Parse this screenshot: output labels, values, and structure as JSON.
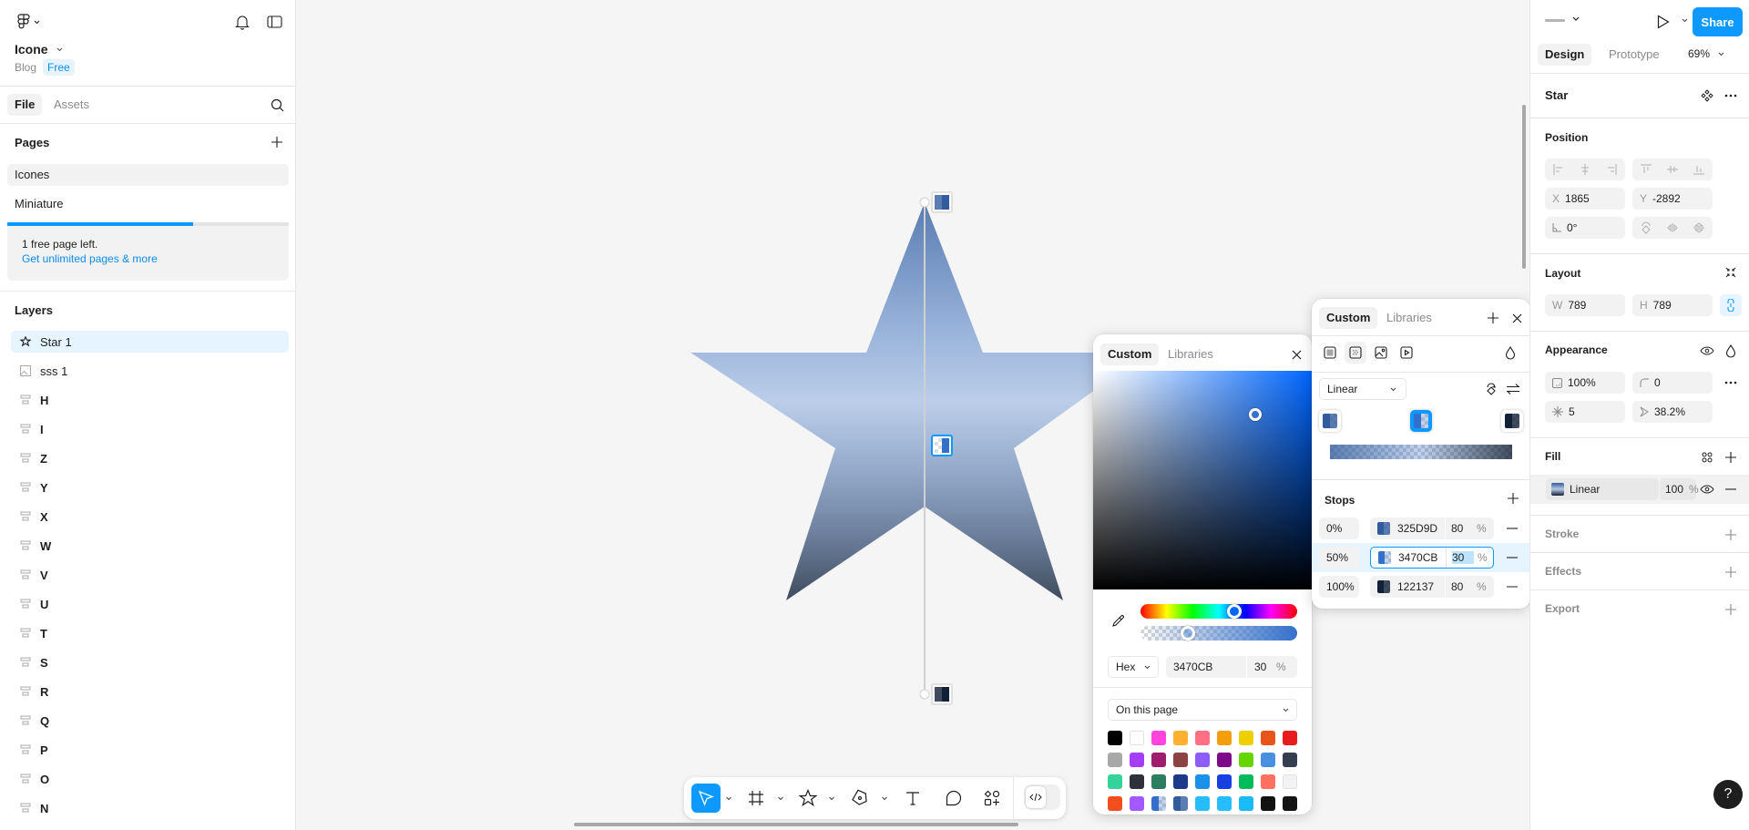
{
  "header": {
    "file_name": "Icone",
    "project": "Blog",
    "plan_badge": "Free"
  },
  "left_tabs": {
    "file": "File",
    "assets": "Assets"
  },
  "pages": {
    "title": "Pages",
    "items": [
      {
        "label": "Icones",
        "active": true
      },
      {
        "label": "Miniature",
        "active": false
      }
    ],
    "upsell": {
      "progress_fraction": 0.66,
      "text": "1 free page left.",
      "link": "Get unlimited pages & more"
    }
  },
  "layers": {
    "title": "Layers",
    "items": [
      {
        "name": "Star 1",
        "icon": "star-icon",
        "selected": true
      },
      {
        "name": "sss 1",
        "icon": "image-icon"
      },
      {
        "name": "H",
        "icon": "auto-layout-icon"
      },
      {
        "name": "I",
        "icon": "auto-layout-icon"
      },
      {
        "name": "Z",
        "icon": "auto-layout-icon"
      },
      {
        "name": "Y",
        "icon": "auto-layout-icon"
      },
      {
        "name": "X",
        "icon": "auto-layout-icon"
      },
      {
        "name": "W",
        "icon": "auto-layout-icon"
      },
      {
        "name": "V",
        "icon": "auto-layout-icon"
      },
      {
        "name": "U",
        "icon": "auto-layout-icon"
      },
      {
        "name": "T",
        "icon": "auto-layout-icon"
      },
      {
        "name": "S",
        "icon": "auto-layout-icon"
      },
      {
        "name": "R",
        "icon": "auto-layout-icon"
      },
      {
        "name": "Q",
        "icon": "auto-layout-icon"
      },
      {
        "name": "P",
        "icon": "auto-layout-icon"
      },
      {
        "name": "O",
        "icon": "auto-layout-icon"
      },
      {
        "name": "N",
        "icon": "auto-layout-icon"
      }
    ]
  },
  "right": {
    "share": "Share",
    "tabs": {
      "design": "Design",
      "prototype": "Prototype"
    },
    "zoom": "69%",
    "selection_title": "Star",
    "position": {
      "title": "Position",
      "x_label": "X",
      "x": "1865",
      "y_label": "Y",
      "y": "-2892",
      "rotation": "0°"
    },
    "layout": {
      "title": "Layout",
      "w_label": "W",
      "w": "789",
      "h_label": "H",
      "h": "789"
    },
    "appearance": {
      "title": "Appearance",
      "opacity": "100%",
      "corner_radius": "0",
      "points": "5",
      "ratio": "38.2%"
    },
    "fill": {
      "title": "Fill",
      "type": "Linear",
      "opacity": "100",
      "pct": "%"
    },
    "stroke": "Stroke",
    "effects": "Effects",
    "export": "Export"
  },
  "gradient_panel": {
    "tabs": {
      "custom": "Custom",
      "libraries": "Libraries"
    },
    "gradient_type": "Linear",
    "stops_title": "Stops",
    "stops": [
      {
        "position": "0%",
        "hex": "325D9D",
        "opacity": "80",
        "pct": "%",
        "color": "#325D9D",
        "alpha": 0.8
      },
      {
        "position": "50%",
        "hex": "3470CB",
        "opacity": "30",
        "pct": "%",
        "color": "#3470CB",
        "alpha": 0.3,
        "selected": true
      },
      {
        "position": "100%",
        "hex": "122137",
        "opacity": "80",
        "pct": "%",
        "color": "#122137",
        "alpha": 0.8
      }
    ]
  },
  "color_picker": {
    "tabs": {
      "custom": "Custom",
      "libraries": "Libraries"
    },
    "hue_deg": 216,
    "saturation": 0.74,
    "brightness": 0.8,
    "opacity_fraction": 0.3,
    "format": "Hex",
    "hex": "3470CB",
    "opacity": "30",
    "pct": "%",
    "library_source": "On this page",
    "swatches": [
      "#000000",
      "#ffffff",
      "#ff44dd",
      "#ffb02e",
      "#ff7085",
      "#f59e0b",
      "#eed000",
      "#e8541a",
      "#e81c1c",
      "#a8a8a8",
      "#a53df5",
      "#a01d6e",
      "#8b4343",
      "#8b5cf6",
      "#7e0a8a",
      "#66d600",
      "#4a90e2",
      "#343e4e",
      "#33d39b",
      "#2f323b",
      "#2d7d60",
      "#1e3a8a",
      "#1991e8",
      "#1740e3",
      "#00bc5a",
      "#ff7060",
      "#f3f3f3",
      "#f24e1e",
      "#a259ff",
      "gradient-a",
      "gradient-b",
      "#27bdfb",
      "#25bdfb",
      "#18bbf5",
      "#111111",
      "#141414"
    ]
  },
  "toolbar": {
    "tools": [
      "move-tool",
      "frame-tool",
      "shape-tool",
      "pen-tool",
      "text-tool",
      "comment-tool",
      "actions-tool"
    ],
    "dev_mode": "dev-mode-toggle"
  },
  "canvas": {
    "gradient_stops": [
      "#325D9D",
      "#3470CB",
      "#122137"
    ]
  }
}
